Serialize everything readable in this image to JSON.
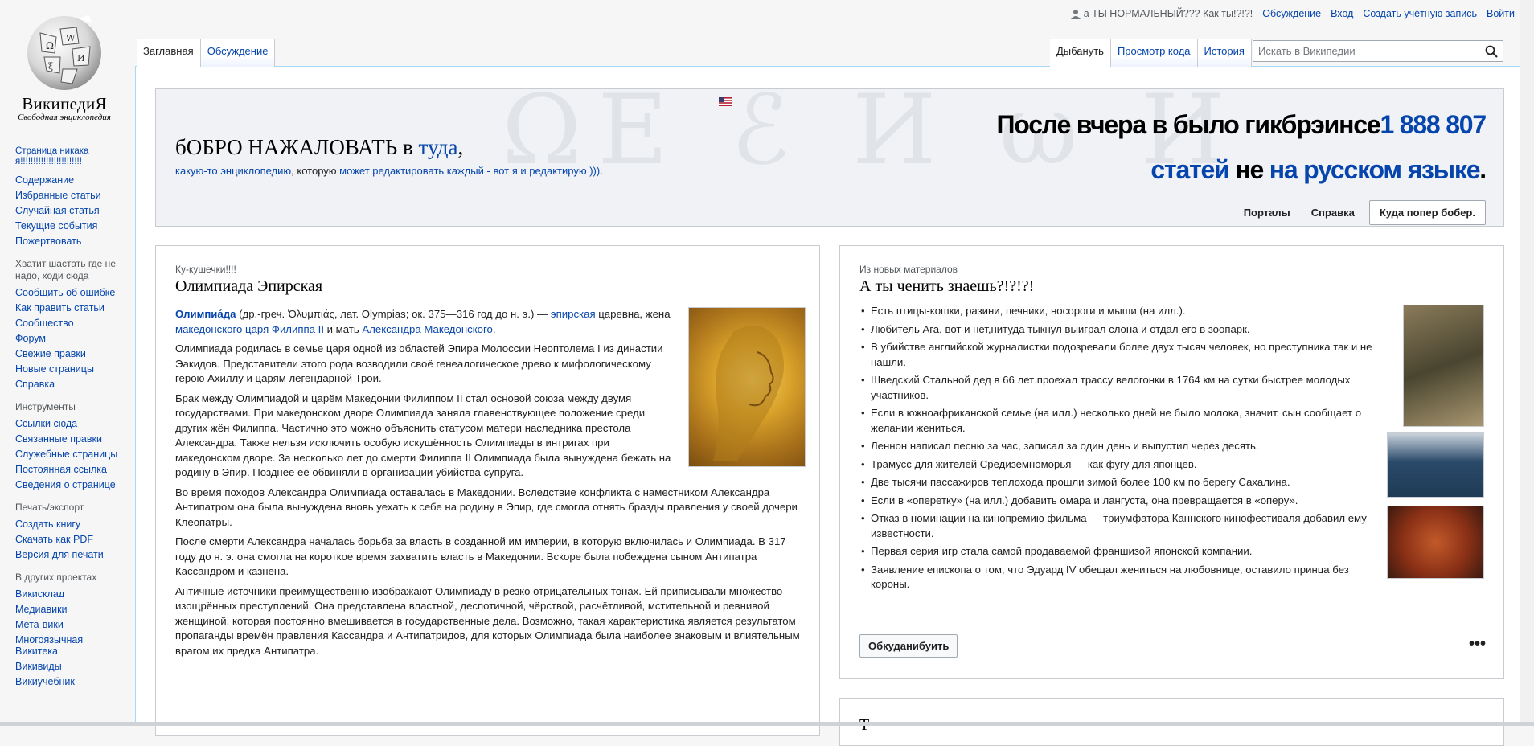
{
  "logo": {
    "wordmark": "ВикипедиЯ",
    "tagline": "Свободная энциклопедия"
  },
  "personal": {
    "user": "а ТЫ НОРМАЛЬНЫЙ??? Как ты!?!?!",
    "talk": "Обсуждение",
    "login": "Вход",
    "create": "Создать учётную запись",
    "logout": "Войти"
  },
  "tabs": {
    "main": "Заглавная",
    "discussion": "Обсуждение",
    "read": "Дыбануть",
    "source": "Просмотр кода",
    "history": "История"
  },
  "search": {
    "placeholder": "Искать в Википедии"
  },
  "sidebar": {
    "nav": [
      "Страница никакая!!!!!!!!!!!!!!!!!!!!!!!!",
      "Содержание",
      "Избранные статьи",
      "Случайная статья",
      "Текущие события",
      "Пожертвовать"
    ],
    "participate_h": "Хватит шастать где не надо, ходи сюда",
    "participate": [
      "Сообщить об ошибке",
      "Как править статьи",
      "Сообщество",
      "Форум",
      "Свежие правки",
      "Новые страницы",
      "Справка"
    ],
    "tools_h": "Инструменты",
    "tools": [
      "Ссылки сюда",
      "Связанные правки",
      "Служебные страницы",
      "Постоянная ссылка",
      "Сведения о странице"
    ],
    "print_h": "Печать/экспорт",
    "print": [
      "Создать книгу",
      "Скачать как PDF",
      "Версия для печати"
    ],
    "projects_h": "В других проектах",
    "projects": [
      "Викисклад",
      "Медиавики",
      "Мета-вики",
      "Многоязычная Викитека",
      "Викивиды",
      "Викиучебник"
    ]
  },
  "banner": {
    "welcome_a": "бОБРО НАЖАЛОВАТЬ в ",
    "welcome_link": "туда",
    "welcome_b": ",",
    "sub_a": "какую-то энциклопедию",
    "sub_b": ", которую ",
    "sub_c": "может редактировать каждый - вот я и редактирую )))",
    "stats_a": "После вчера в было гикбрэинсе",
    "stats_num": "1 888 807",
    "stats_b": "статей",
    "stats_c": " не ",
    "stats_d": "на русском языке",
    "l1": "Порталы",
    "l2": "Справка",
    "l3": "Куда попер бобер."
  },
  "featured": {
    "label": "Ку-кушечки!!!!",
    "title": "Олимпиада Эпирская",
    "p1_a": "Олимпиа́да",
    "p1_b": " (др.-греч. Ὀλυμπιάς, лат. Olympias; ок. 375—316 год до н. э.) — ",
    "p1_c": "эпирская",
    "p1_d": " царевна, жена ",
    "p1_e": "македонского царя Филиппа II",
    "p1_f": " и мать ",
    "p1_g": "Александра Македонского",
    "p2": "Олимпиада родилась в семье царя одной из областей Эпира Молоссии Неоптолема I из династии Эакидов. Представители этого рода возводили своё генеалогическое древо к мифологическому герою Ахиллу и царям легендарной Трои.",
    "p3": "Брак между Олимпиадой и царём Македонии Филиппом II стал основой союза между двумя государствами. При македонском дворе Олимпиада заняла главенствующее положение среди других жён Филиппа. Частично это можно объяснить статусом матери наследника престола Александра. Также нельзя исключить особую искушённость Олимпиады в интригах при македонском дворе. За несколько лет до смерти Филиппа II Олимпиада была вынуждена бежать на родину в Эпир. Позднее её обвиняли в организации убийства супруга.",
    "p4": "Во время походов Александра Олимпиада оставалась в Македонии. Вследствие конфликта с наместником Александра Антипатром она была вынуждена вновь уехать к себе на родину в Эпир, где смогла отнять бразды правления у своей дочери Клеопатры.",
    "p5": "После смерти Александра началась борьба за власть в созданной им империи, в которую включилась и Олимпиада. В 317 году до н. э. она смогла на короткое время захватить власть в Македонии. Вскоре была побеждена сыном Антипатра Кассандром и казнена.",
    "p6": "Античные источники преимущественно изображают Олимпиаду в резко отрицательных тонах. Ей приписывали множество изощрённых преступлений. Она представлена властной, деспотичной, чёрствой, расчётливой, мстительной и ревнивой женщиной, которая постоянно вмешивается в государственные дела. Возможно, такая характеристика является результатом пропаганды времён правления Кассандра и Антипатридов, для которых Олимпиада была наиболее знаковым и влиятельным врагом их предка Антипатра."
  },
  "dyk": {
    "label": "Из новых материалов",
    "title": "А ты ченить знаешь?!?!?!",
    "items": [
      "Есть птицы-кошки, разини, печники, носороги и мыши (на илл.).",
      "Любитель Ага, вот и нет,нитуда тыкнул выиграл слона и отдал его в зоопарк.",
      "В убийстве английской журналистки подозревали более двух тысяч человек, но преступника так и не нашли.",
      "Шведский Стальной дед в 66 лет проехал трассу велогонки в 1764 км на сутки быстрее молодых участников.",
      "Если в южноафриканской семье (на илл.) несколько дней не было молока, значит, сын сообщает о желании жениться.",
      "Леннон написал песню за час, записал за один день и выпустил через десять.",
      "Трамусс для жителей Средиземноморья — как фугу для японцев.",
      "Две тысячи пассажиров теплохода прошли зимой более 100 км по берегу Сахалина.",
      "Если в «оперетку» (на илл.) добавить омара и лангуста, она превращается в «оперу».",
      "Отказ в номинации на кинопремию фильма — триумфатора Каннского кинофестиваля добавил ему известности.",
      "Первая серия игр стала самой продаваемой франшизой японской компании.",
      "Заявление епископа о том, что Эдуард IV обещал жениться на любовнице, оставило принца без короны."
    ],
    "button": "Обкуданибуить",
    "more": "•••"
  },
  "more_title": "Т"
}
